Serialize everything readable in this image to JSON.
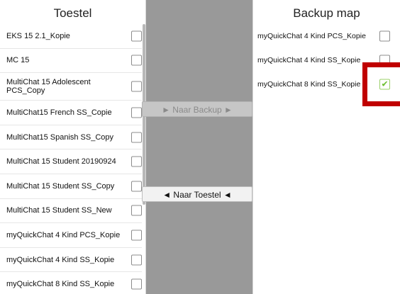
{
  "left_panel": {
    "title": "Toestel",
    "items": [
      {
        "label": "EKS 15 2.1_Kopie",
        "checked": false
      },
      {
        "label": "MC 15",
        "checked": false
      },
      {
        "label": "MultiChat 15 Adolescent PCS_Copy",
        "checked": false
      },
      {
        "label": "MultiChat15 French SS_Copie",
        "checked": false
      },
      {
        "label": "MultiChat15 Spanish SS_Copy",
        "checked": false
      },
      {
        "label": "MultiChat 15 Student 20190924",
        "checked": false
      },
      {
        "label": "MultiChat 15 Student SS_Copy",
        "checked": false
      },
      {
        "label": "MultiChat 15 Student SS_New",
        "checked": false
      },
      {
        "label": "myQuickChat 4 Kind PCS_Kopie",
        "checked": false
      },
      {
        "label": "myQuickChat 4 Kind SS_Kopie",
        "checked": false
      },
      {
        "label": "myQuickChat 8 Kind SS_Kopie",
        "checked": false
      }
    ]
  },
  "middle_panel": {
    "to_backup_label": "► Naar Backup ►",
    "to_device_label": "◄ Naar Toestel ◄",
    "to_backup_enabled": false
  },
  "right_panel": {
    "title": "Backup map",
    "items": [
      {
        "label": "myQuickChat 4 Kind PCS_Kopie",
        "checked": false
      },
      {
        "label": "myQuickChat 4 Kind SS_Kopie",
        "checked": false
      },
      {
        "label": "myQuickChat 8 Kind SS_Kopie",
        "checked": true,
        "check_glyph": "✔"
      }
    ]
  },
  "colors": {
    "middle_background": "#999999",
    "highlight_box": "#c00000",
    "check_mark": "#6cbf30"
  }
}
